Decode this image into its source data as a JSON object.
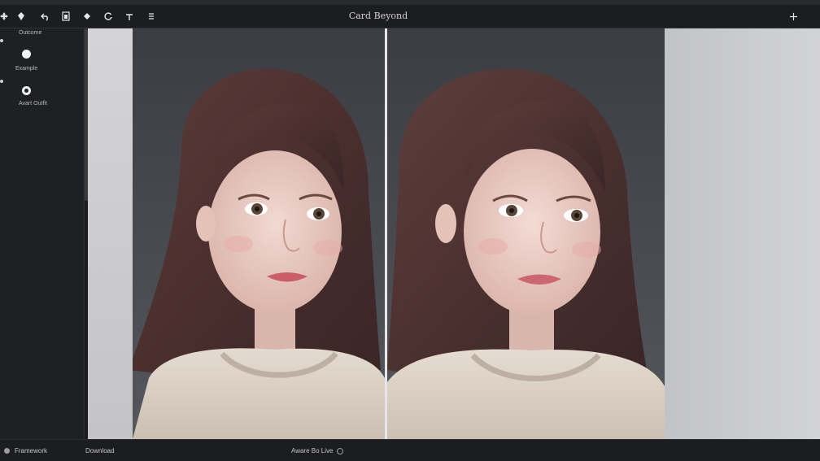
{
  "toolbar": {
    "title": "Card Beyond",
    "tools": [
      {
        "name": "move-tool-icon",
        "glyph": "✥"
      },
      {
        "name": "undo-icon",
        "glyph": "↶"
      },
      {
        "name": "layer-icon",
        "glyph": "▣"
      },
      {
        "name": "fill-icon",
        "glyph": "◆"
      },
      {
        "name": "rotate-icon",
        "glyph": "↻"
      },
      {
        "name": "pin-icon",
        "glyph": "+"
      },
      {
        "name": "menu-icon",
        "glyph": "≡"
      }
    ],
    "add_label": "+"
  },
  "sidebar": {
    "section_title": "Outcome",
    "options": [
      {
        "label": "Example",
        "state": "filled"
      },
      {
        "label": "Avart Outfit",
        "state": "ring"
      }
    ]
  },
  "status": {
    "left_label": "Framework",
    "center_label": "Download",
    "right_label": "Aware Bo Live"
  },
  "colors": {
    "background": "#1b1c1f",
    "canvas": "#c9cacd",
    "accent": "#f2f2f4"
  }
}
